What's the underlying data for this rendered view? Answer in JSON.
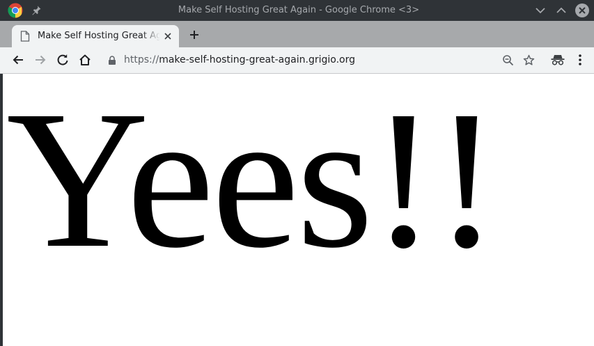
{
  "window": {
    "title": "Make Self Hosting Great Again - Google Chrome <3>"
  },
  "tabs": [
    {
      "title": "Make Self Hosting Great Again"
    }
  ],
  "toolbar": {
    "url_scheme": "https://",
    "url_host": "make-self-hosting-great-again.grigio.org"
  },
  "page": {
    "heading": "Yees!!"
  },
  "icons": {
    "chrome_logo": "chrome-logo-icon",
    "pin": "pin-icon",
    "minimize": "chevron-down-icon",
    "maximize": "chevron-up-icon",
    "close": "close-icon",
    "tab_page": "page-icon",
    "tab_close": "close-icon",
    "new_tab": "plus-icon",
    "back": "arrow-left-icon",
    "forward": "arrow-right-icon",
    "reload": "reload-icon",
    "home": "home-icon",
    "lock": "lock-icon",
    "zoom": "zoom-out-icon",
    "bookmark": "star-icon",
    "incognito": "incognito-icon",
    "menu": "kebab-menu-icon"
  },
  "colors": {
    "titlebar": "#2f3337",
    "tabstrip": "#a7a9ab",
    "toolbar": "#f1f3f4",
    "title_text": "#a6a9ad",
    "page_background": "#ffffff",
    "heading_text": "#000000"
  }
}
